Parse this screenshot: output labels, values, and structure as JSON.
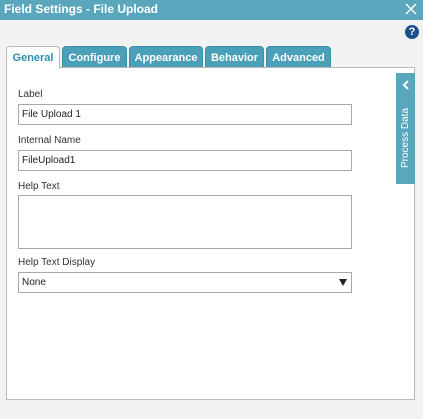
{
  "window": {
    "title": "Field Settings - File Upload",
    "help_glyph": "?"
  },
  "tabs": [
    {
      "label": "General",
      "active": true
    },
    {
      "label": "Configure",
      "active": false
    },
    {
      "label": "Appearance",
      "active": false
    },
    {
      "label": "Behavior",
      "active": false
    },
    {
      "label": "Advanced",
      "active": false
    }
  ],
  "form": {
    "label_field": {
      "label": "Label",
      "value": "File Upload 1"
    },
    "internal_name": {
      "label": "Internal Name",
      "value": "FileUpload1"
    },
    "help_text": {
      "label": "Help Text",
      "value": ""
    },
    "help_text_display": {
      "label": "Help Text Display",
      "selected": "None"
    }
  },
  "side_panel": {
    "label": "Process Data"
  },
  "colors": {
    "titlebar": "#5aa6bd",
    "tab_inactive": "#4a9fb9",
    "tab_active_text": "#2f8fb0",
    "help_icon": "#1c4f8a"
  },
  "icons": {
    "close": "close-icon",
    "help": "help-icon",
    "chevron": "chevron-left-icon",
    "dropdown": "dropdown-arrow-icon"
  }
}
